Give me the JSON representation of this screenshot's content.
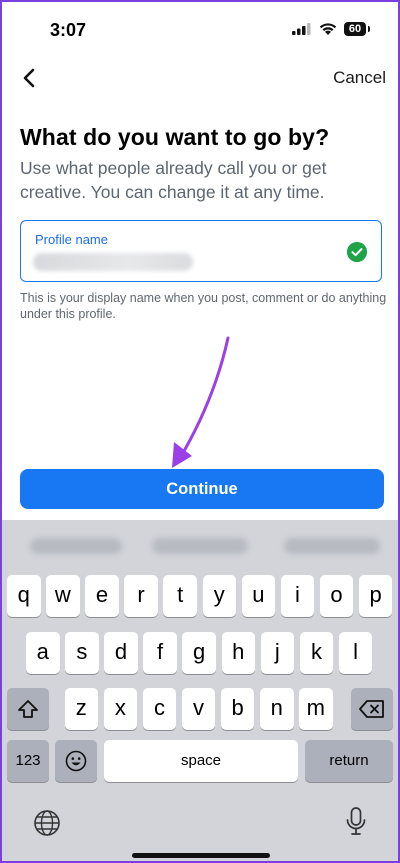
{
  "status_bar": {
    "time": "3:07",
    "battery": "60"
  },
  "nav": {
    "cancel_label": "Cancel"
  },
  "heading": {
    "title": "What do you want to go by?",
    "subtitle": "Use what people already call you or get creative. You can change it at any time."
  },
  "profile_field": {
    "label": "Profile name",
    "helper": "This is your display name when you post, comment or do anything under this profile."
  },
  "continue_label": "Continue",
  "keyboard": {
    "row1": [
      "q",
      "w",
      "e",
      "r",
      "t",
      "y",
      "u",
      "i",
      "o",
      "p"
    ],
    "row2": [
      "a",
      "s",
      "d",
      "f",
      "g",
      "h",
      "j",
      "k",
      "l"
    ],
    "row3": [
      "z",
      "x",
      "c",
      "v",
      "b",
      "n",
      "m"
    ],
    "numbers_label": "123",
    "space_label": "space",
    "return_label": "return"
  },
  "colors": {
    "accent": "#1877f2",
    "success": "#1ea446",
    "annotation": "#9b3fe6"
  }
}
